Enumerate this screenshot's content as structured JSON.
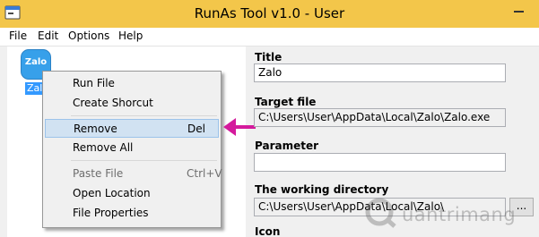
{
  "window": {
    "title": "RunAs Tool v1.0 - User",
    "accent": "#f3c64a"
  },
  "menubar": {
    "items": [
      "File",
      "Edit",
      "Options",
      "Help"
    ]
  },
  "list": {
    "item": {
      "icon_text": "Zalo",
      "label": "Zalo",
      "icon_color": "#37a0ea"
    }
  },
  "context_menu": {
    "items": [
      {
        "label": "Run File",
        "shortcut": ""
      },
      {
        "label": "Create Shorcut",
        "shortcut": ""
      },
      {
        "label": "Remove",
        "shortcut": "Del",
        "highlighted": true
      },
      {
        "label": "Remove All",
        "shortcut": ""
      },
      {
        "label": "Paste File",
        "shortcut": "Ctrl+V",
        "disabled": true
      },
      {
        "label": "Open Location",
        "shortcut": ""
      },
      {
        "label": "File Properties",
        "shortcut": ""
      }
    ]
  },
  "arrow": {
    "color": "#d41a9c"
  },
  "form": {
    "title_label": "Title",
    "title_value": "Zalo",
    "target_label": "Target file",
    "target_value": "C:\\Users\\User\\AppData\\Local\\Zalo\\Zalo.exe",
    "parameter_label": "Parameter",
    "parameter_value": "",
    "workdir_label": "The working directory",
    "workdir_value": "C:\\Users\\User\\AppData\\Local\\Zalo\\",
    "browse_label": "...",
    "icon_label": "Icon"
  },
  "watermark": {
    "text": "uantrimang"
  }
}
